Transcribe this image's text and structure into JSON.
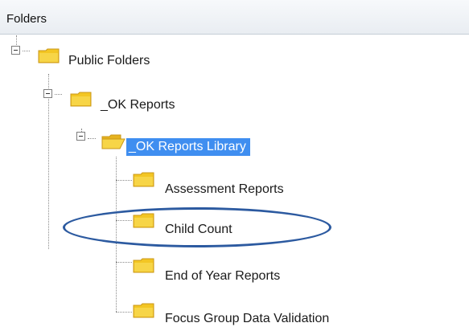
{
  "header": {
    "title": "Folders"
  },
  "tree": {
    "root": {
      "label": "Public Folders",
      "expanded": true,
      "icon": "folder-icon"
    },
    "level1": {
      "label": "_OK Reports",
      "expanded": true,
      "icon": "folder-icon"
    },
    "level2": {
      "label": "_OK Reports Library",
      "expanded": true,
      "selected": true,
      "icon": "folder-open-icon"
    },
    "children": [
      {
        "label": "Assessment Reports",
        "icon": "folder-icon"
      },
      {
        "label": "Child Count",
        "icon": "folder-icon",
        "circled": true
      },
      {
        "label": "End of Year Reports",
        "icon": "folder-icon"
      },
      {
        "label": "Focus Group Data Validation",
        "icon": "folder-icon"
      }
    ]
  },
  "colors": {
    "selection": "#3f8ef0",
    "folder_fill": "#f3c623",
    "folder_border": "#c9971a",
    "circle": "#2c5aa0"
  }
}
